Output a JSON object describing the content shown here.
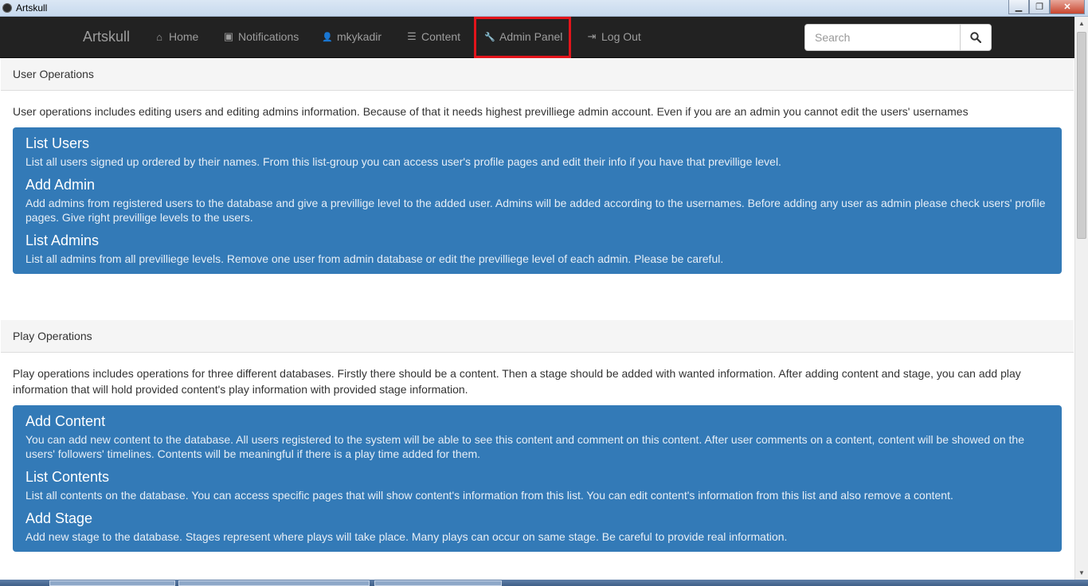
{
  "window": {
    "title": "Artskull",
    "controls": {
      "minimize": "▁",
      "maximize": "❐",
      "close": "✕"
    }
  },
  "navbar": {
    "brand": "Artskull",
    "items": [
      {
        "label": "Home",
        "icon": "home-icon",
        "glyph": "⌂"
      },
      {
        "label": "Notifications",
        "icon": "inbox-icon",
        "glyph": "▣"
      },
      {
        "label": "mkykadir",
        "icon": "user-icon",
        "glyph": "👤"
      },
      {
        "label": "Content",
        "icon": "list-icon",
        "glyph": "☰"
      },
      {
        "label": "Admin Panel",
        "icon": "wrench-icon",
        "glyph": "🔧"
      },
      {
        "label": "Log Out",
        "icon": "logout-icon",
        "glyph": "⇥"
      }
    ],
    "search": {
      "placeholder": "Search",
      "value": ""
    }
  },
  "user_operations": {
    "heading": "User Operations",
    "description": "User operations includes editing users and editing admins information. Because of that it needs highest previlliege admin account. Even if you are an admin you cannot edit the users' usernames",
    "items": [
      {
        "title": "List Users",
        "text": "List all users signed up ordered by their names. From this list-group you can access user's profile pages and edit their info if you have that previllige level."
      },
      {
        "title": "Add Admin",
        "text": "Add admins from registered users to the database and give a previllige level to the added user. Admins will be added according to the usernames. Before adding any user as admin please check users' profile pages. Give right previllige levels to the users."
      },
      {
        "title": "List Admins",
        "text": "List all admins from all previlliege levels. Remove one user from admin database or edit the previlliege level of each admin. Please be careful."
      }
    ]
  },
  "play_operations": {
    "heading": "Play Operations",
    "description": "Play operations includes operations for three different databases. Firstly there should be a content. Then a stage should be added with wanted information. After adding content and stage, you can add play information that will hold provided content's play information with provided stage information.",
    "items": [
      {
        "title": "Add Content",
        "text": "You can add new content to the database. All users registered to the system will be able to see this content and comment on this content. After user comments on a content, content will be showed on the users' followers' timelines. Contents will be meaningful if there is a play time added for them."
      },
      {
        "title": "List Contents",
        "text": "List all contents on the database. You can access specific pages that will show content's information from this list. You can edit content's information from this list and also remove a content."
      },
      {
        "title": "Add Stage",
        "text": "Add new stage to the database. Stages represent where plays will take place. Many plays can occur on same stage. Be careful to provide real information."
      }
    ]
  },
  "colors": {
    "navbar_bg": "#222222",
    "list_bg": "#337ab7",
    "highlight_border": "#e3141b"
  }
}
